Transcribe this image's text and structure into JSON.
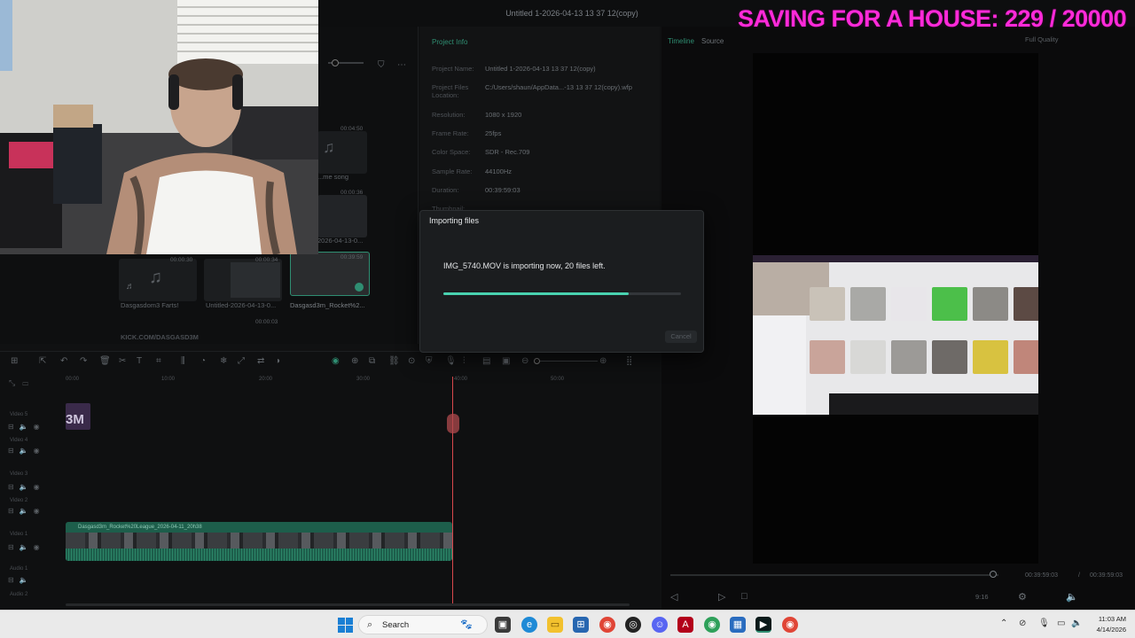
{
  "window": {
    "title": "Untitled 1-2026-04-13 13 37 12(copy)"
  },
  "overlay": {
    "saving_text": "SAVING FOR A HOUSE: 229 / 20000"
  },
  "media": {
    "items": [
      {
        "label": "Dasgasdom3 Farts!",
        "duration": "00:00:30"
      },
      {
        "label": "Untitled-2026-04-13-0...",
        "duration": "00:00:34"
      },
      {
        "label": "Dasgasd3m_Rocket%2...",
        "duration": "00:39:59"
      },
      {
        "label": "...me song",
        "duration": "00:04:50"
      },
      {
        "label": "2026-04-13-0...",
        "duration": "00:00:36"
      },
      {
        "label": "KICK.COM/DASGASD3M",
        "duration": "00:00:03"
      }
    ]
  },
  "project_info": {
    "header": "Project Info",
    "rows": [
      {
        "key": "Project Name:",
        "value": "Untitled 1-2026-04-13 13 37 12(copy)"
      },
      {
        "key": "Project Files Location:",
        "value": "C:/Users/shaun/AppData...-13 13 37 12(copy).wfp"
      },
      {
        "key": "Resolution:",
        "value": "1080 x 1920"
      },
      {
        "key": "Frame Rate:",
        "value": "25fps"
      },
      {
        "key": "Color Space:",
        "value": "SDR - Rec.709"
      },
      {
        "key": "Sample Rate:",
        "value": "44100Hz"
      },
      {
        "key": "Duration:",
        "value": "00:39:59:03"
      },
      {
        "key": "Thumbnail:",
        "value": ""
      }
    ]
  },
  "preview": {
    "tab_timeline": "Timeline",
    "tab_source": "Source",
    "quality": "Full Quality",
    "time_current": "00:39:59:03",
    "time_separator": "/",
    "time_total": "00:39:59:03",
    "aspect": "9:16"
  },
  "timeline": {
    "ruler": [
      "00:00",
      "10:00",
      "20:00",
      "30:00",
      "40:00",
      "50:00"
    ],
    "tracks": [
      "Video 5",
      "Video 4",
      "Video 3",
      "Video 2",
      "Video 1",
      "Audio 1",
      "Audio 2"
    ],
    "clip_label": "Dasgasd3m_Rocket%20League_2026-04-11_20h38",
    "small_clip_text": "3M"
  },
  "dialog": {
    "title": "Importing files",
    "message": "IMG_5740.MOV is importing now, 20 files left.",
    "progress": 0.78,
    "cancel_label": "Cancel"
  },
  "taskbar": {
    "search_placeholder": "Search",
    "time": "11:03 AM",
    "date": "4/14/2026"
  },
  "colors": {
    "accent": "#2f8e72",
    "progress": "#49d2b0",
    "overlay_text": "#ff2ad9",
    "playhead": "#d8484c"
  }
}
